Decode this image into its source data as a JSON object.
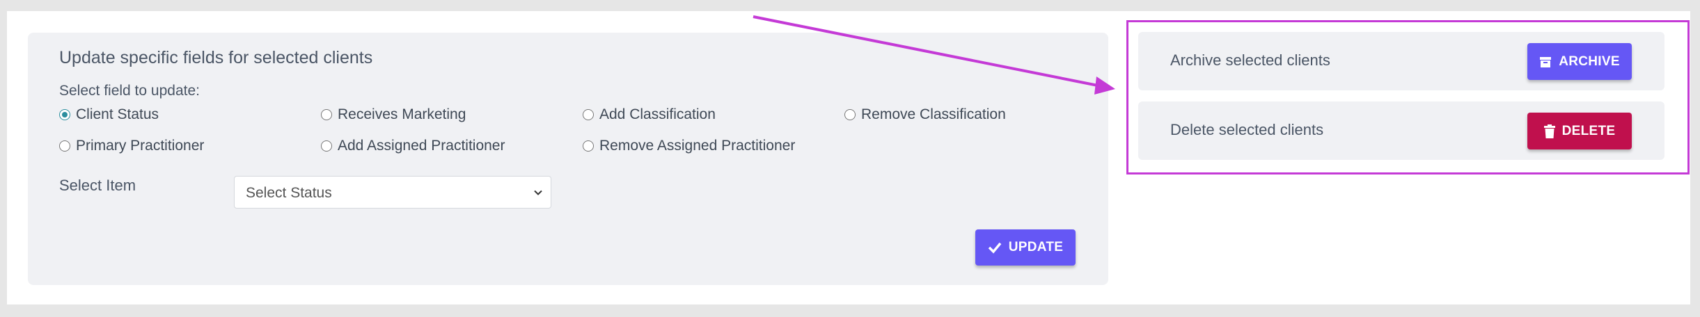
{
  "update_panel": {
    "title": "Update specific fields for selected clients",
    "field_label": "Select field to update:",
    "radios": [
      {
        "label": "Client Status",
        "checked": true
      },
      {
        "label": "Receives Marketing",
        "checked": false
      },
      {
        "label": "Add Classification",
        "checked": false
      },
      {
        "label": "Remove Classification",
        "checked": false
      },
      {
        "label": "Primary Practitioner",
        "checked": false
      },
      {
        "label": "Add Assigned Practitioner",
        "checked": false
      },
      {
        "label": "Remove Assigned Practitioner",
        "checked": false
      }
    ],
    "select_item_label": "Select Item",
    "select_value": "Select Status",
    "update_button": "UPDATE"
  },
  "archive_panel": {
    "label": "Archive selected clients",
    "button": "ARCHIVE"
  },
  "delete_panel": {
    "label": "Delete selected clients",
    "button": "DELETE"
  },
  "colors": {
    "primary": "#6557f5",
    "danger": "#c0104d",
    "highlight": "#c43ad6",
    "radio_checked": "#2b8e9e"
  }
}
